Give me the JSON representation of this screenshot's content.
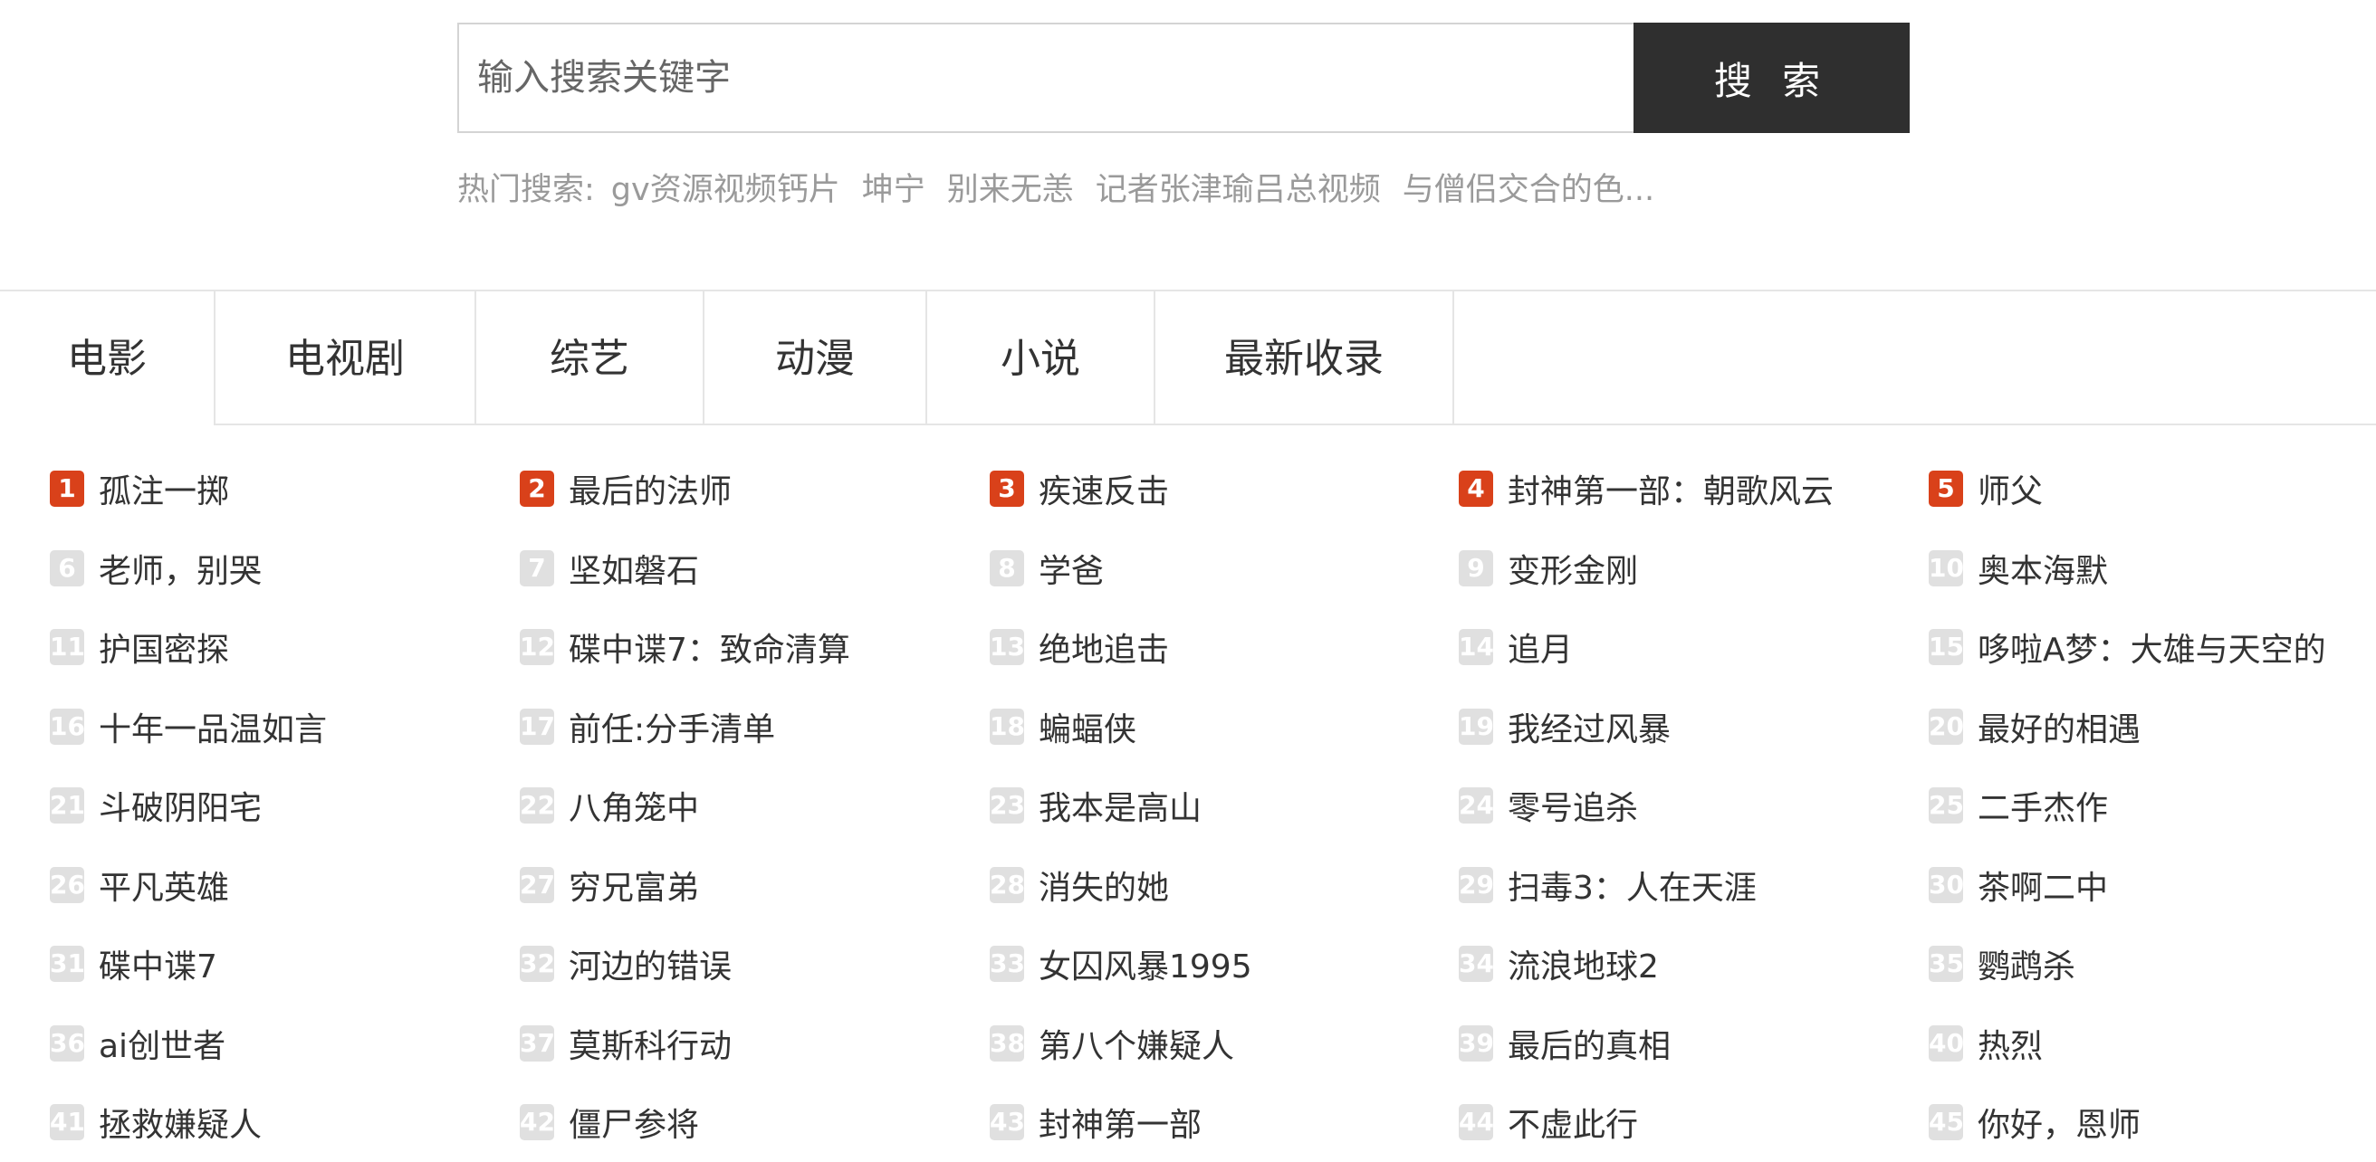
{
  "search": {
    "placeholder": "输入搜索关键字",
    "button_label": "搜 索"
  },
  "hot_search": {
    "label": "热门搜索:",
    "items": [
      "gv资源视频钙片",
      "坤宁",
      "别来无恙",
      "记者张津瑜吕总视频",
      "与僧侣交合的色..."
    ]
  },
  "tabs": [
    {
      "label": "电影",
      "active": true
    },
    {
      "label": "电视剧",
      "active": false
    },
    {
      "label": "综艺",
      "active": false
    },
    {
      "label": "动漫",
      "active": false
    },
    {
      "label": "小说",
      "active": false
    },
    {
      "label": "最新收录",
      "active": false
    }
  ],
  "colors": {
    "top_rank": "#d9411a",
    "rank": "#e0e0e0",
    "search_button": "#2f2f2f",
    "muted_text": "#9a9a9a"
  },
  "ranking": [
    {
      "rank": "1",
      "title": "孤注一掷"
    },
    {
      "rank": "2",
      "title": "最后的法师"
    },
    {
      "rank": "3",
      "title": "疾速反击"
    },
    {
      "rank": "4",
      "title": "封神第一部：朝歌风云"
    },
    {
      "rank": "5",
      "title": "师父"
    },
    {
      "rank": "6",
      "title": "老师，别哭"
    },
    {
      "rank": "7",
      "title": "坚如磐石"
    },
    {
      "rank": "8",
      "title": "学爸"
    },
    {
      "rank": "9",
      "title": "变形金刚"
    },
    {
      "rank": "10",
      "title": "奥本海默"
    },
    {
      "rank": "11",
      "title": "护国密探"
    },
    {
      "rank": "12",
      "title": "碟中谍7：致命清算"
    },
    {
      "rank": "13",
      "title": "绝地追击"
    },
    {
      "rank": "14",
      "title": "追月"
    },
    {
      "rank": "15",
      "title": "哆啦A梦：大雄与天空的"
    },
    {
      "rank": "16",
      "title": "十年一品温如言"
    },
    {
      "rank": "17",
      "title": "前任:分手清单"
    },
    {
      "rank": "18",
      "title": "蝙蝠侠"
    },
    {
      "rank": "19",
      "title": "我经过风暴"
    },
    {
      "rank": "20",
      "title": "最好的相遇"
    },
    {
      "rank": "21",
      "title": "斗破阴阳宅"
    },
    {
      "rank": "22",
      "title": "八角笼中"
    },
    {
      "rank": "23",
      "title": "我本是高山"
    },
    {
      "rank": "24",
      "title": "零号追杀"
    },
    {
      "rank": "25",
      "title": "二手杰作"
    },
    {
      "rank": "26",
      "title": "平凡英雄"
    },
    {
      "rank": "27",
      "title": "穷兄富弟"
    },
    {
      "rank": "28",
      "title": "消失的她"
    },
    {
      "rank": "29",
      "title": "扫毒3：人在天涯"
    },
    {
      "rank": "30",
      "title": "茶啊二中"
    },
    {
      "rank": "31",
      "title": "碟中谍7"
    },
    {
      "rank": "32",
      "title": "河边的错误"
    },
    {
      "rank": "33",
      "title": "女囚风暴1995"
    },
    {
      "rank": "34",
      "title": "流浪地球2"
    },
    {
      "rank": "35",
      "title": "鹦鹉杀"
    },
    {
      "rank": "36",
      "title": "ai创世者"
    },
    {
      "rank": "37",
      "title": "莫斯科行动"
    },
    {
      "rank": "38",
      "title": "第八个嫌疑人"
    },
    {
      "rank": "39",
      "title": "最后的真相"
    },
    {
      "rank": "40",
      "title": "热烈"
    },
    {
      "rank": "41",
      "title": "拯救嫌疑人"
    },
    {
      "rank": "42",
      "title": "僵尸参将"
    },
    {
      "rank": "43",
      "title": "封神第一部"
    },
    {
      "rank": "44",
      "title": "不虚此行"
    },
    {
      "rank": "45",
      "title": "你好，恩师"
    }
  ]
}
